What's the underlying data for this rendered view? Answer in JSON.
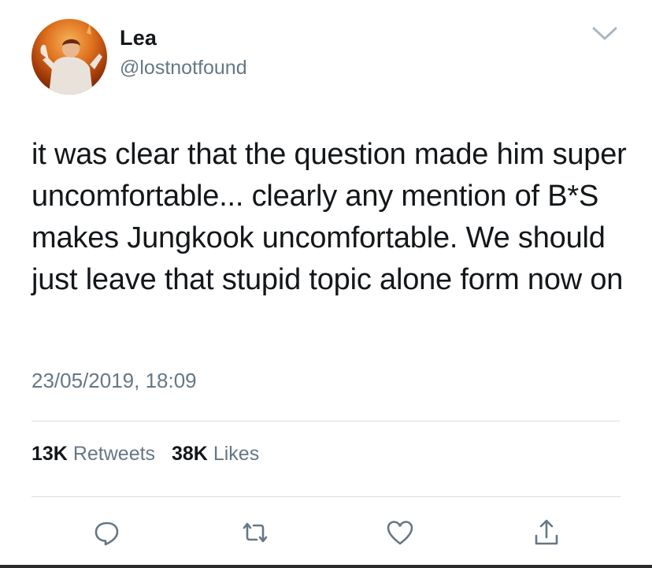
{
  "user": {
    "display_name": "Lea",
    "handle": "@lostnotfound",
    "avatar": "profile-photo"
  },
  "tweet": {
    "text": "it was clear that the question made him super uncomfortable... clearly any mention of B*S makes Jungkook uncomfortable. We should just leave that stupid topic alone form now on",
    "timestamp": "23/05/2019, 18:09"
  },
  "stats": {
    "retweets_count": "13K",
    "retweets_label": "Retweets",
    "likes_count": "38K",
    "likes_label": "Likes"
  },
  "actions": {
    "reply_icon": "reply-icon",
    "retweet_icon": "retweet-icon",
    "like_icon": "heart-icon",
    "share_icon": "share-icon"
  },
  "colors": {
    "primary_text": "#14171a",
    "secondary_text": "#657786",
    "divider": "#d8dde2",
    "icon": "#657786"
  }
}
